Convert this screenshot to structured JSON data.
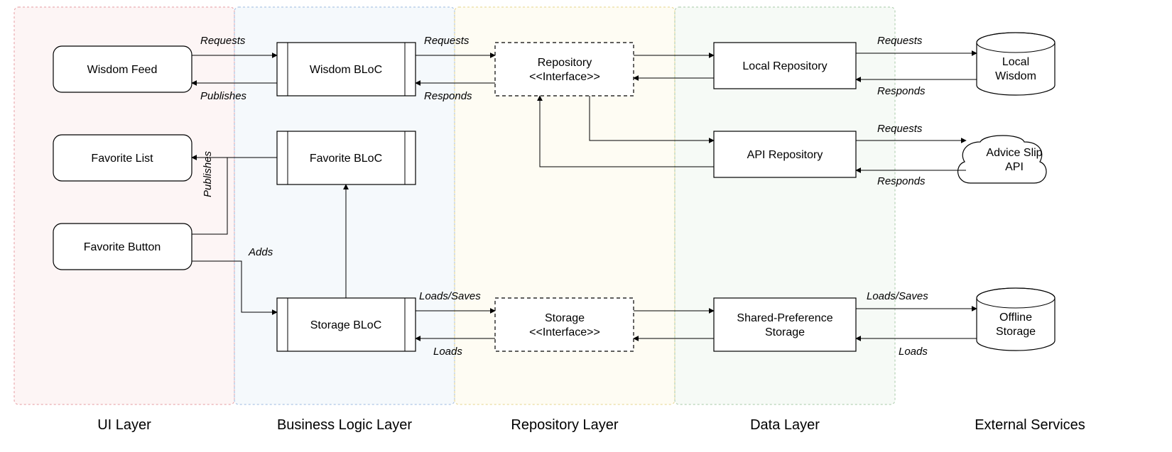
{
  "layers": {
    "ui": {
      "label": "UI Layer",
      "fill": "#f8d7d8",
      "stroke": "#e59aa0"
    },
    "logic": {
      "label": "Business Logic Layer",
      "fill": "#d9e6f5",
      "stroke": "#9bb9e0"
    },
    "repo": {
      "label": "Repository Layer",
      "fill": "#fdf3cf",
      "stroke": "#e6d48a"
    },
    "data": {
      "label": "Data Layer",
      "fill": "#dcebdc",
      "stroke": "#a6c8a6"
    },
    "ext": {
      "label": "External Services"
    }
  },
  "nodes": {
    "wisdomFeed": {
      "label": "Wisdom Feed"
    },
    "favoriteList": {
      "label": "Favorite List"
    },
    "favoriteButton": {
      "label": "Favorite Button"
    },
    "wisdomBloc": {
      "label": "Wisdom BLoC"
    },
    "favoriteBloc": {
      "label": "Favorite BLoC"
    },
    "storageBloc": {
      "label": "Storage BLoC"
    },
    "repoIface": {
      "line1": "Repository",
      "line2": "<<Interface>>"
    },
    "storageIface": {
      "line1": "Storage",
      "line2": "<<Interface>>"
    },
    "localRepo": {
      "label": "Local Repository"
    },
    "apiRepo": {
      "label": "API Repository"
    },
    "sharedPref": {
      "line1": "Shared-Preference",
      "line2": "Storage"
    },
    "localWisdom": {
      "line1": "Local",
      "line2": "Wisdom"
    },
    "adviceApi": {
      "line1": "Advice Slip",
      "line2": "API"
    },
    "offlineStorage": {
      "line1": "Offline",
      "line2": "Storage"
    }
  },
  "edges": {
    "requests": "Requests",
    "publishes": "Publishes",
    "responds": "Responds",
    "adds": "Adds",
    "loadsSaves": "Loads/Saves",
    "loads": "Loads"
  }
}
